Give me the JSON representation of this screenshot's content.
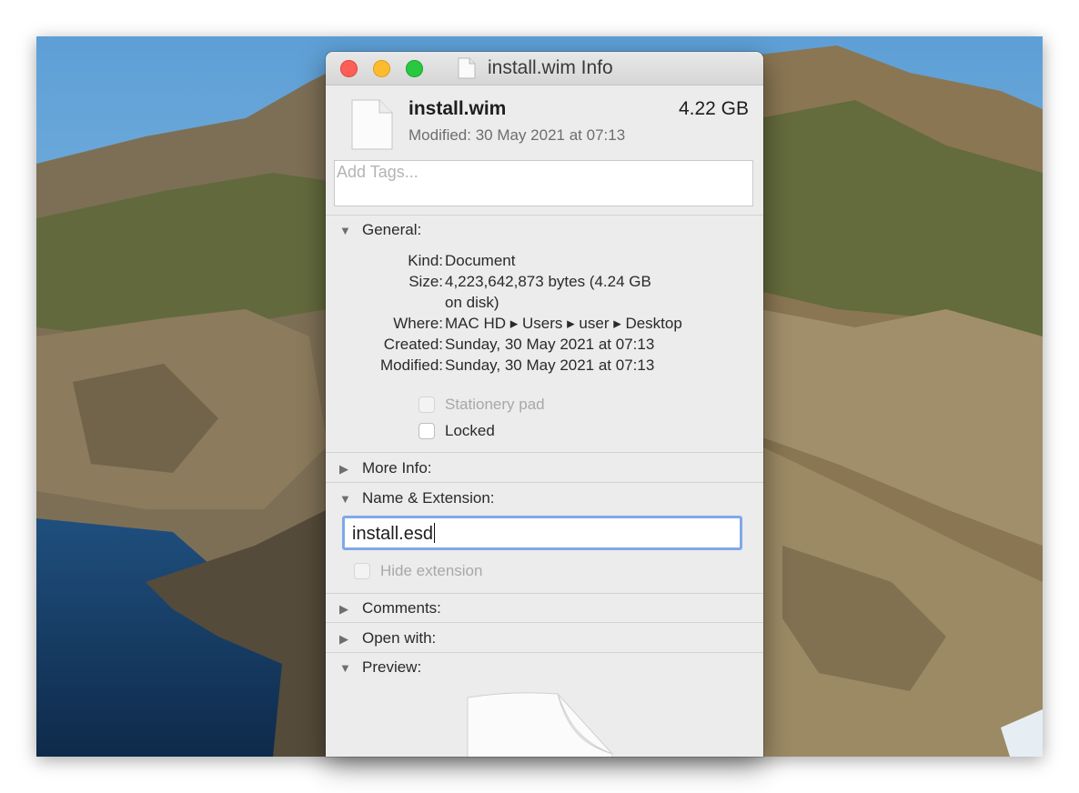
{
  "window": {
    "title": "install.wim Info"
  },
  "file": {
    "name": "install.wim",
    "size": "4.22 GB",
    "modified": "Modified: 30 May 2021 at 07:13"
  },
  "tags": {
    "placeholder": "Add Tags..."
  },
  "general": {
    "header": "General:",
    "expanded": true,
    "rows": [
      {
        "label": "Kind:",
        "value": "Document"
      },
      {
        "label": "Size:",
        "value": "4,223,642,873 bytes (4.24 GB",
        "value2": "on disk)"
      },
      {
        "label": "Where:",
        "value": "MAC HD ▸ Users ▸ user ▸ Desktop"
      },
      {
        "label": "Created:",
        "value": "Sunday, 30 May 2021 at 07:13"
      },
      {
        "label": "Modified:",
        "value": "Sunday, 30 May 2021 at 07:13"
      }
    ],
    "stationery_label": "Stationery pad",
    "stationery_checked": false,
    "locked_label": "Locked",
    "locked_checked": false
  },
  "more_info": {
    "header": "More Info:",
    "expanded": false
  },
  "name_extension": {
    "header": "Name & Extension:",
    "expanded": true,
    "value": "install.esd",
    "hide_extension_label": "Hide extension",
    "hide_extension_checked": false
  },
  "comments": {
    "header": "Comments:",
    "expanded": false
  },
  "open_with": {
    "header": "Open with:",
    "expanded": false
  },
  "preview": {
    "header": "Preview:",
    "expanded": true
  },
  "icons": {
    "disclosure_open": "▼",
    "disclosure_closed": "▶",
    "file": "document-icon"
  },
  "colors": {
    "close": "#fc5f57",
    "minimize": "#fdbc2e",
    "zoom": "#28c840",
    "focus_ring": "#7fa8ea"
  }
}
